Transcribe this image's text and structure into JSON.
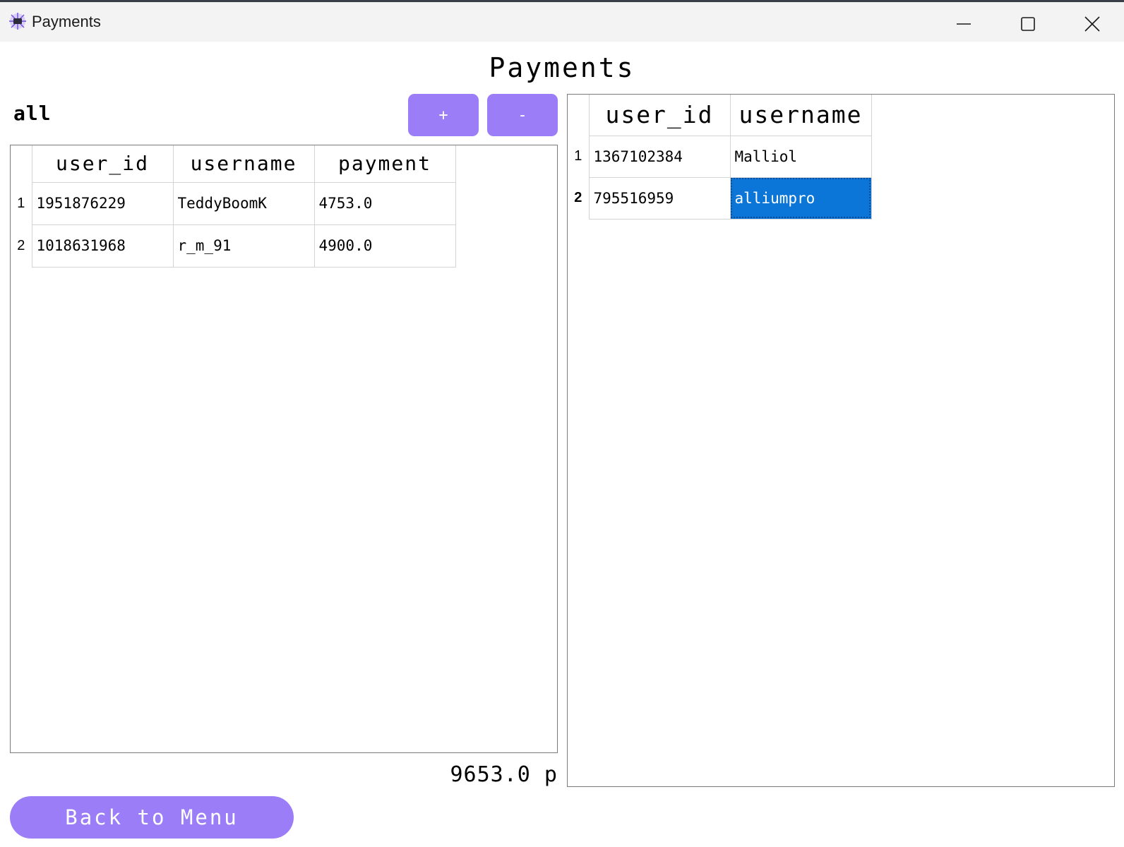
{
  "window": {
    "title": "Payments"
  },
  "header": {
    "title": "Payments"
  },
  "filter": {
    "label": "all"
  },
  "buttons": {
    "add_label": "+",
    "remove_label": "-",
    "back_label": "Back to Menu"
  },
  "payments_table": {
    "columns": [
      "user_id",
      "username",
      "payment"
    ],
    "rows": [
      {
        "index": "1",
        "user_id": "1951876229",
        "username": "TeddyBoomK",
        "payment": "4753.0"
      },
      {
        "index": "2",
        "user_id": "1018631968",
        "username": "r_m_91",
        "payment": "4900.0"
      }
    ]
  },
  "users_table": {
    "columns": [
      "user_id",
      "username"
    ],
    "rows": [
      {
        "index": "1",
        "user_id": "1367102384",
        "username": "Malliol"
      },
      {
        "index": "2",
        "user_id": "795516959",
        "username": "alliumpro"
      }
    ],
    "selected_row": 2
  },
  "total": {
    "text": "9653.0 p"
  },
  "colors": {
    "accent": "#9b7df8",
    "selection": "#0b76d8"
  }
}
